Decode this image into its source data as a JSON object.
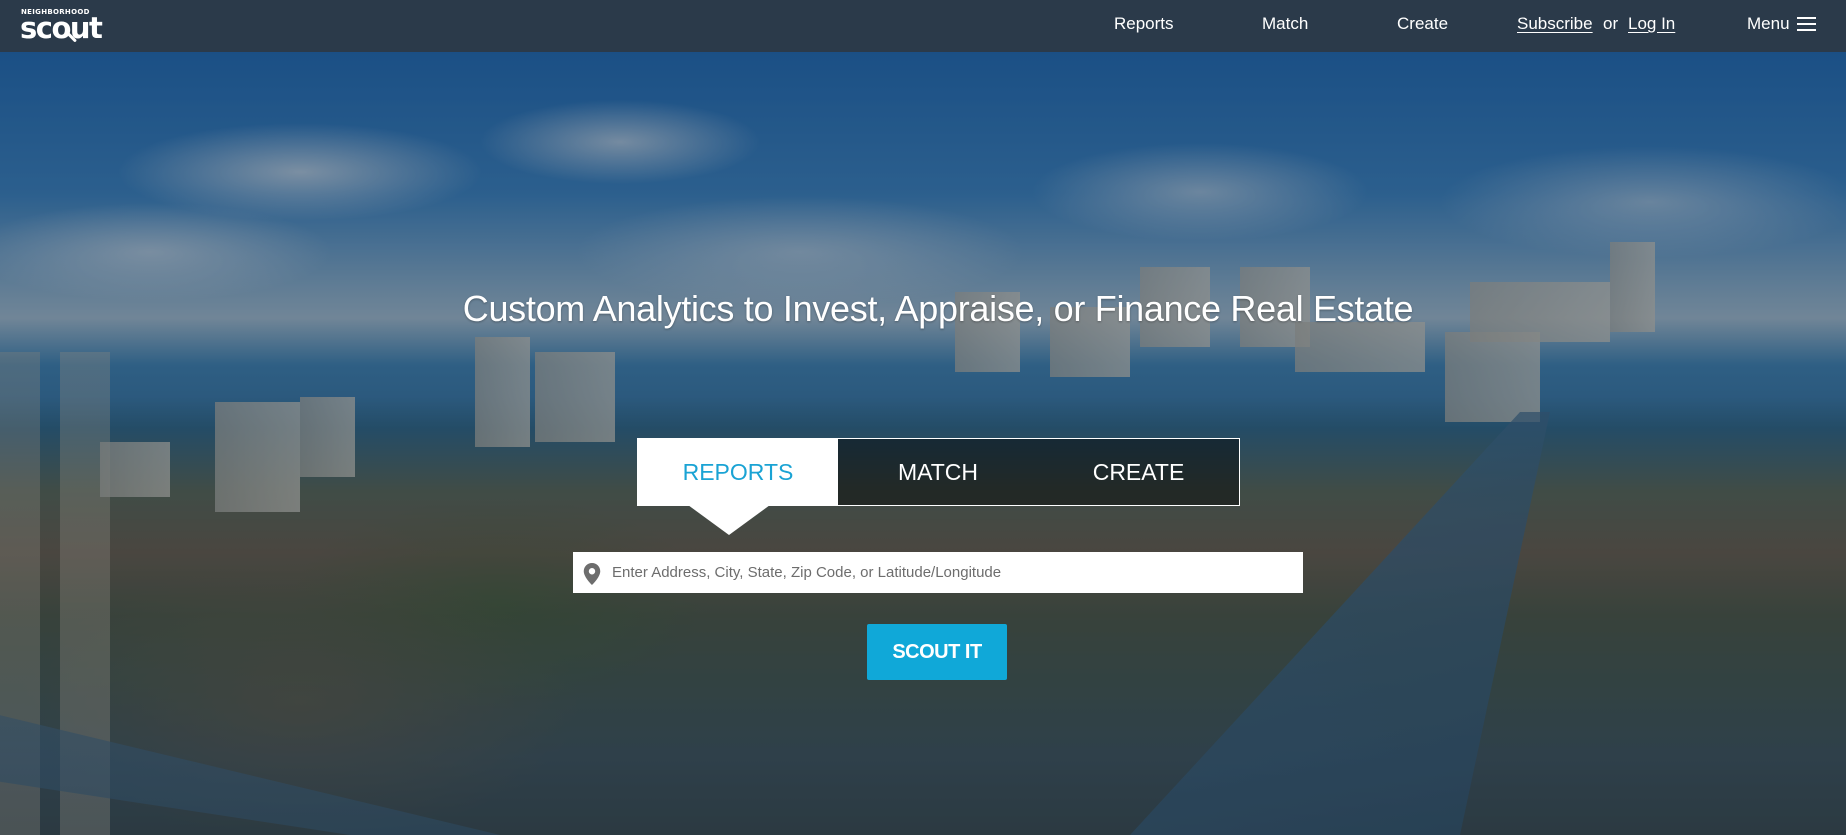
{
  "nav": {
    "logo_small": "NEIGHBORHOOD",
    "logo_big": "scout",
    "links": {
      "reports": "Reports",
      "match": "Match",
      "create": "Create",
      "subscribe": "Subscribe",
      "or": "or",
      "login": "Log In",
      "menu": "Menu"
    },
    "menu_icon": "hamburger-icon"
  },
  "hero": {
    "headline": "Custom Analytics to Invest, Appraise, or Finance Real Estate",
    "tabs": [
      {
        "label": "REPORTS",
        "active": true
      },
      {
        "label": "MATCH",
        "active": false
      },
      {
        "label": "CREATE",
        "active": false
      }
    ],
    "search": {
      "icon": "map-pin-icon",
      "placeholder": "Enter Address, City, State, Zip Code, or Latitude/Longitude",
      "value": ""
    },
    "button_label": "SCOUT IT"
  },
  "colors": {
    "nav_bg": "#2b3a4a",
    "accent": "#10a8d8",
    "active_tab_text": "#1aa3d4"
  }
}
